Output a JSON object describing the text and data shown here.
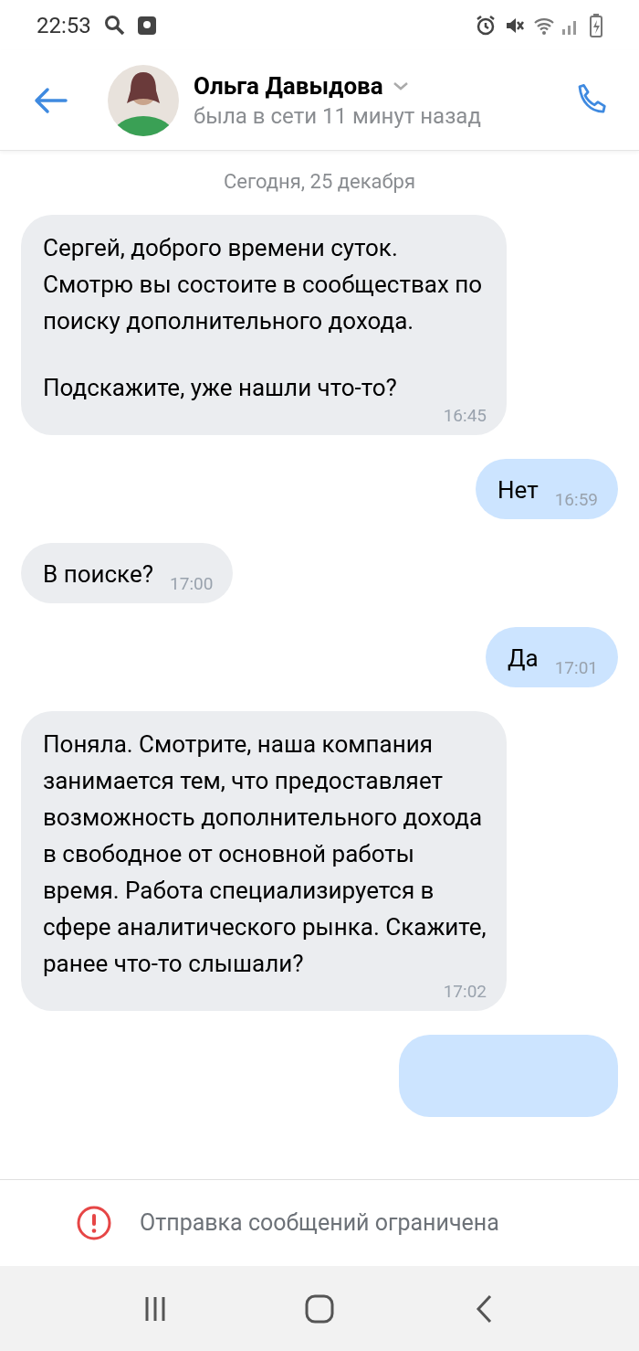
{
  "status_bar": {
    "time": "22:53"
  },
  "header": {
    "name": "Ольга Давыдова",
    "status": "была в сети 11 минут назад"
  },
  "date_divider": "Сегодня, 25 декабря",
  "messages": [
    {
      "outgoing": false,
      "kind": "block",
      "paragraphs": [
        "Сергей, доброго времени суток. Смотрю вы состоите в сообществах по поиску дополнительного дохода.",
        "Подскажите, уже нашли что-то?"
      ],
      "time": "16:45"
    },
    {
      "outgoing": true,
      "kind": "inline",
      "paragraphs": [
        "Нет"
      ],
      "time": "16:59"
    },
    {
      "outgoing": false,
      "kind": "inline",
      "paragraphs": [
        "В поиске?"
      ],
      "time": "17:00"
    },
    {
      "outgoing": true,
      "kind": "inline",
      "paragraphs": [
        "Да"
      ],
      "time": "17:01"
    },
    {
      "outgoing": false,
      "kind": "block",
      "paragraphs": [
        "Поняла. Смотрите, наша компания занимается тем, что предоставляет возможность дополнительного дохода в свободное от основной работы время. Работа специализируется в сфере аналитического рынка. Скажите, ранее что-то слышали?"
      ],
      "time": "17:02"
    },
    {
      "outgoing": true,
      "kind": "cut"
    }
  ],
  "restriction_notice": "Отправка сообщений ограничена"
}
